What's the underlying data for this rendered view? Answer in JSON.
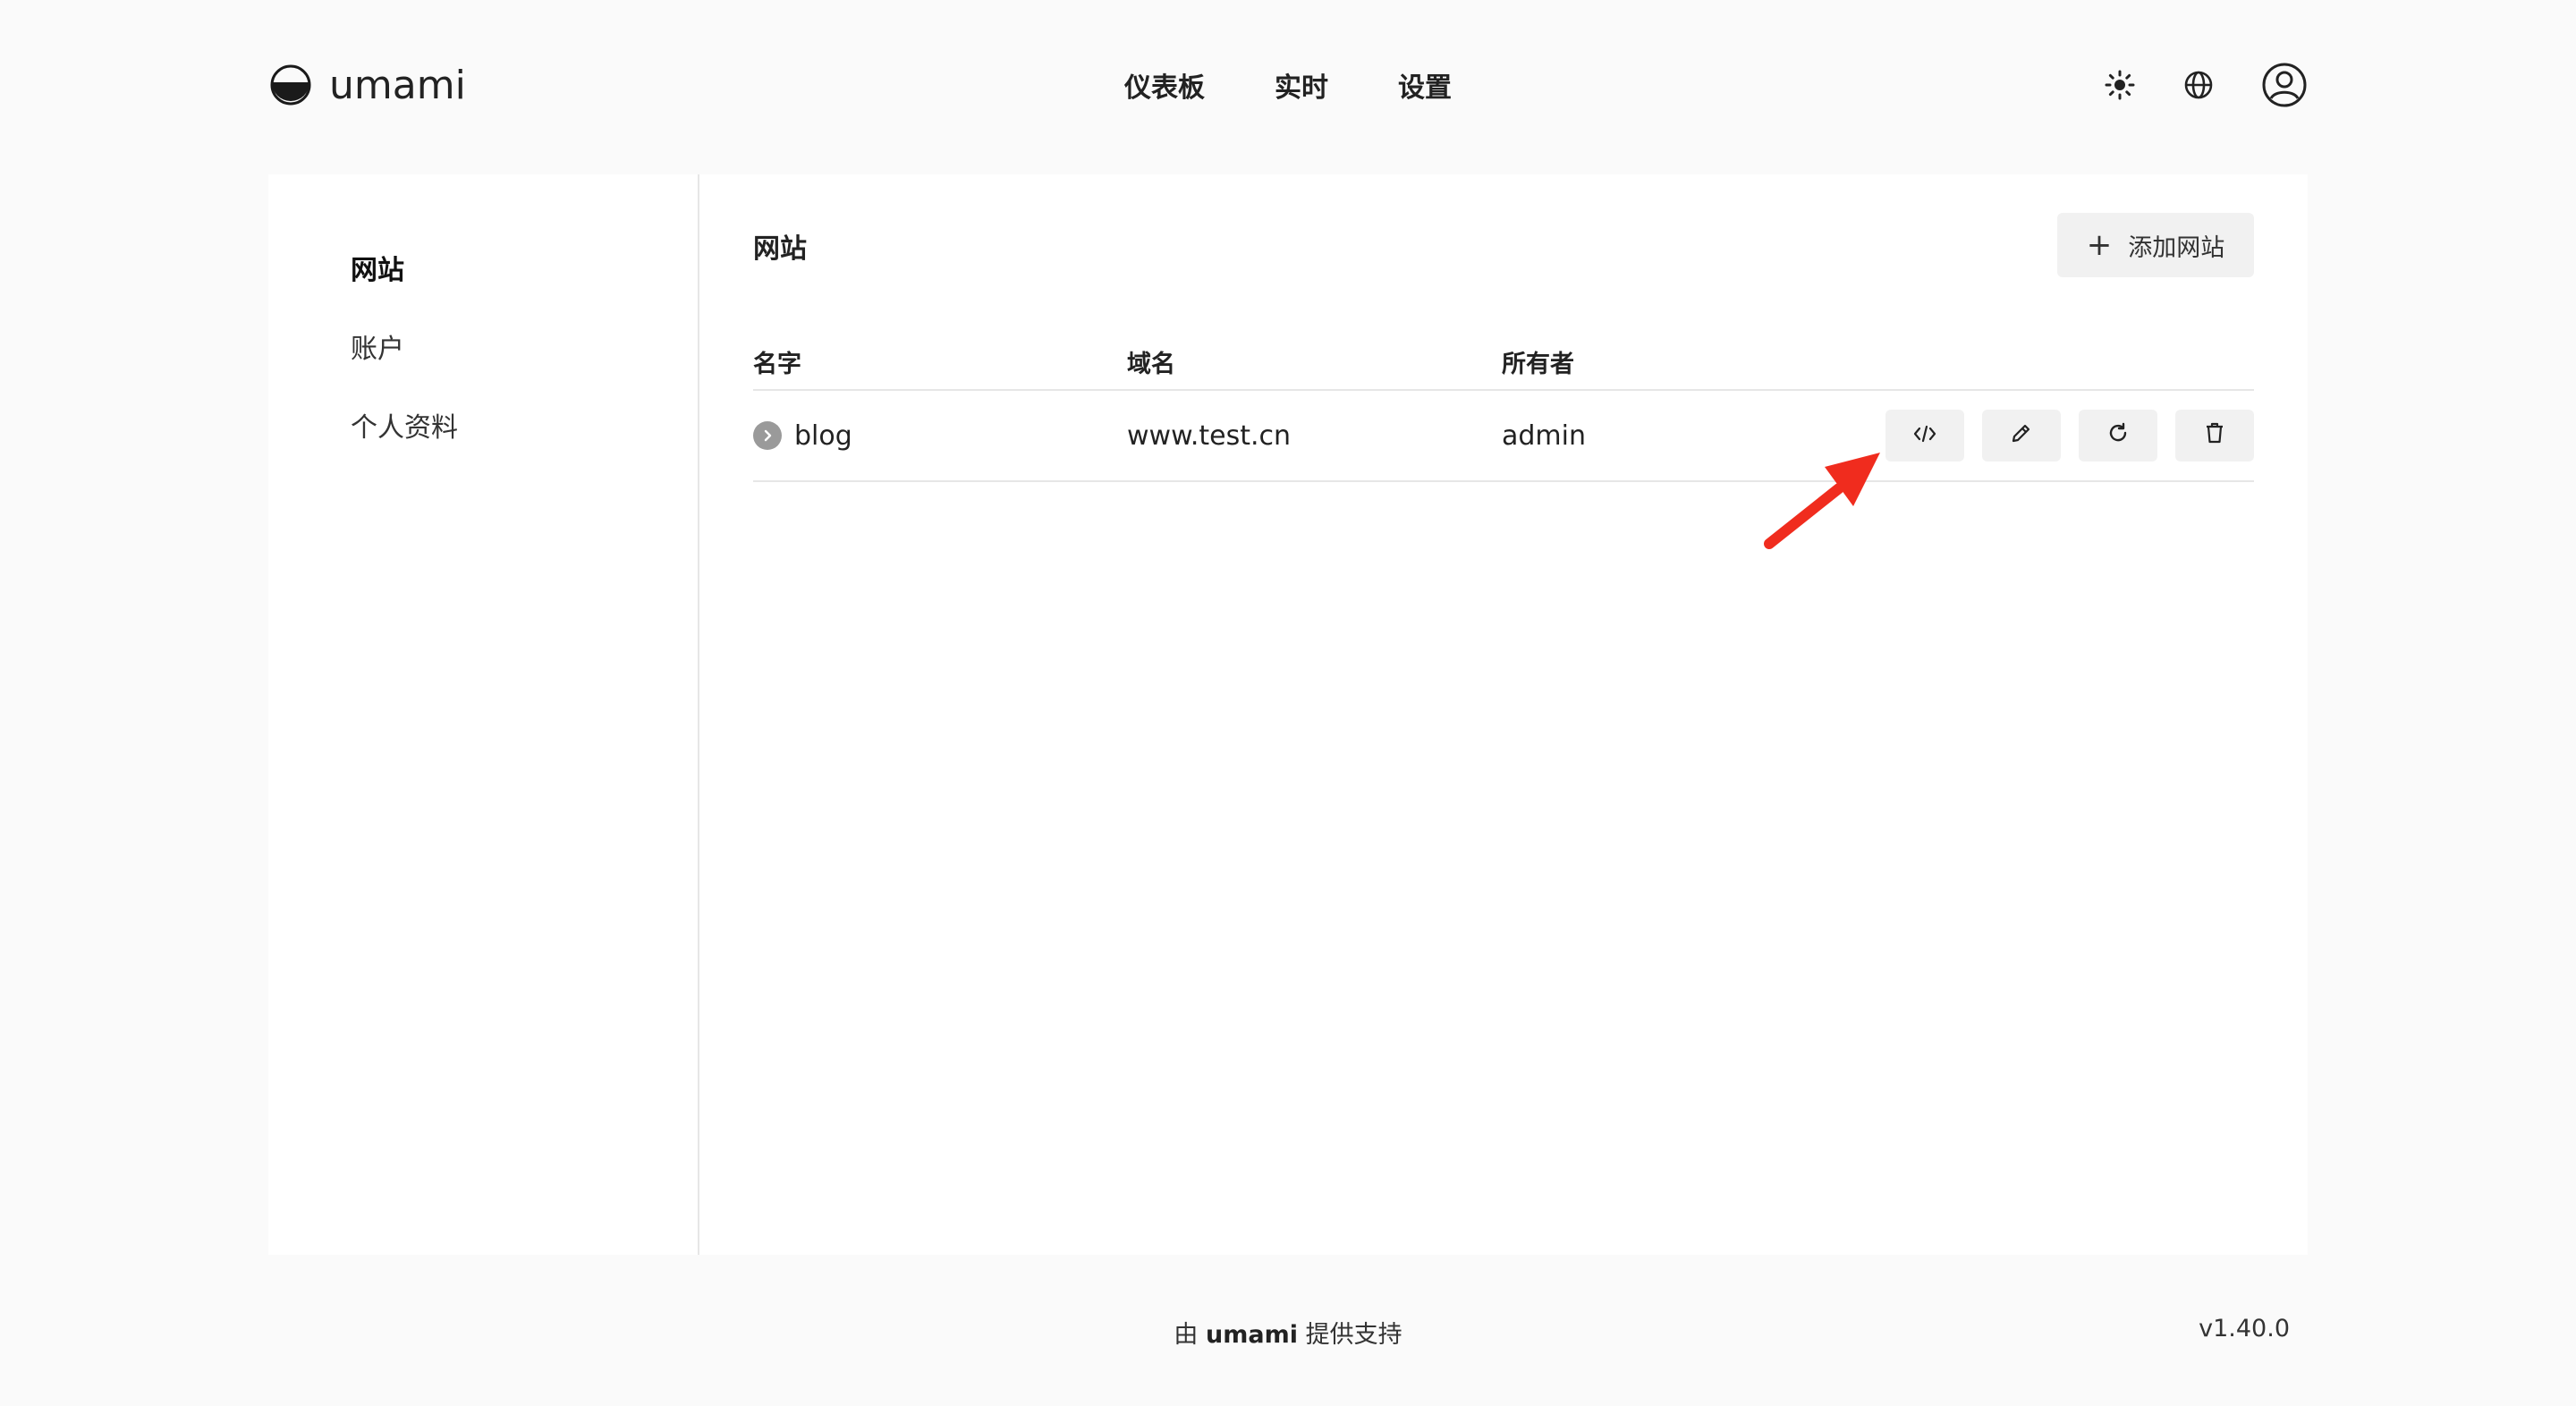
{
  "header": {
    "brand": "umami",
    "nav": [
      "仪表板",
      "实时",
      "设置"
    ],
    "icons": [
      "sun-icon",
      "globe-icon",
      "user-circle-icon"
    ]
  },
  "sidebar": {
    "items": [
      {
        "label": "网站",
        "active": true
      },
      {
        "label": "账户",
        "active": false
      },
      {
        "label": "个人资料",
        "active": false
      }
    ]
  },
  "main": {
    "title": "网站",
    "add_button": "添加网站",
    "table": {
      "columns": [
        "名字",
        "域名",
        "所有者"
      ],
      "rows": [
        {
          "name": "blog",
          "domain": "www.test.cn",
          "owner": "admin"
        }
      ],
      "row_actions": [
        "code-icon",
        "pencil-icon",
        "refresh-icon",
        "trash-icon"
      ]
    }
  },
  "footer": {
    "prefix": "由",
    "brand": "umami",
    "suffix": "提供支持",
    "version": "v1.40.0"
  },
  "colors": {
    "page_bg": "#fafafa",
    "card_bg": "#ffffff",
    "button_bg": "#f1f1f1",
    "arrow": "#f02c1e"
  }
}
